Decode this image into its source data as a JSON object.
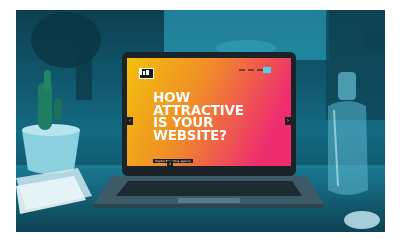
{
  "screen": {
    "headline": "HOW\nATTRACTIVE\nIS YOUR\nWEBSITE?",
    "tagline": "Digital Branding agency",
    "logo_icon": "brand-logo",
    "arrow_left_glyph": "‹",
    "arrow_right_glyph": "›",
    "scroll_glyph": "↓"
  },
  "colors": {
    "overlay": "#0f5c73",
    "screen_gradient_start": "#f2c10a",
    "screen_gradient_end": "#ee2d6e",
    "accent_button": "#4fd2e6"
  }
}
